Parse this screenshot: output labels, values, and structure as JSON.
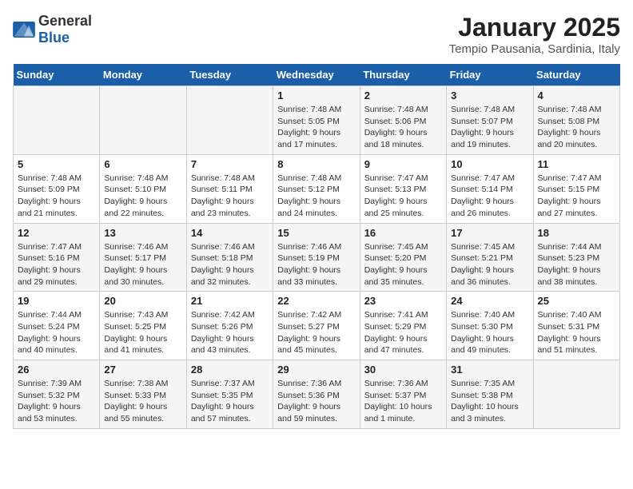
{
  "header": {
    "logo": {
      "general": "General",
      "blue": "Blue"
    },
    "title": "January 2025",
    "subtitle": "Tempio Pausania, Sardinia, Italy"
  },
  "weekdays": [
    "Sunday",
    "Monday",
    "Tuesday",
    "Wednesday",
    "Thursday",
    "Friday",
    "Saturday"
  ],
  "weeks": [
    [
      {
        "day": "",
        "info": ""
      },
      {
        "day": "",
        "info": ""
      },
      {
        "day": "",
        "info": ""
      },
      {
        "day": "1",
        "info": "Sunrise: 7:48 AM\nSunset: 5:05 PM\nDaylight: 9 hours\nand 17 minutes."
      },
      {
        "day": "2",
        "info": "Sunrise: 7:48 AM\nSunset: 5:06 PM\nDaylight: 9 hours\nand 18 minutes."
      },
      {
        "day": "3",
        "info": "Sunrise: 7:48 AM\nSunset: 5:07 PM\nDaylight: 9 hours\nand 19 minutes."
      },
      {
        "day": "4",
        "info": "Sunrise: 7:48 AM\nSunset: 5:08 PM\nDaylight: 9 hours\nand 20 minutes."
      }
    ],
    [
      {
        "day": "5",
        "info": "Sunrise: 7:48 AM\nSunset: 5:09 PM\nDaylight: 9 hours\nand 21 minutes."
      },
      {
        "day": "6",
        "info": "Sunrise: 7:48 AM\nSunset: 5:10 PM\nDaylight: 9 hours\nand 22 minutes."
      },
      {
        "day": "7",
        "info": "Sunrise: 7:48 AM\nSunset: 5:11 PM\nDaylight: 9 hours\nand 23 minutes."
      },
      {
        "day": "8",
        "info": "Sunrise: 7:48 AM\nSunset: 5:12 PM\nDaylight: 9 hours\nand 24 minutes."
      },
      {
        "day": "9",
        "info": "Sunrise: 7:47 AM\nSunset: 5:13 PM\nDaylight: 9 hours\nand 25 minutes."
      },
      {
        "day": "10",
        "info": "Sunrise: 7:47 AM\nSunset: 5:14 PM\nDaylight: 9 hours\nand 26 minutes."
      },
      {
        "day": "11",
        "info": "Sunrise: 7:47 AM\nSunset: 5:15 PM\nDaylight: 9 hours\nand 27 minutes."
      }
    ],
    [
      {
        "day": "12",
        "info": "Sunrise: 7:47 AM\nSunset: 5:16 PM\nDaylight: 9 hours\nand 29 minutes."
      },
      {
        "day": "13",
        "info": "Sunrise: 7:46 AM\nSunset: 5:17 PM\nDaylight: 9 hours\nand 30 minutes."
      },
      {
        "day": "14",
        "info": "Sunrise: 7:46 AM\nSunset: 5:18 PM\nDaylight: 9 hours\nand 32 minutes."
      },
      {
        "day": "15",
        "info": "Sunrise: 7:46 AM\nSunset: 5:19 PM\nDaylight: 9 hours\nand 33 minutes."
      },
      {
        "day": "16",
        "info": "Sunrise: 7:45 AM\nSunset: 5:20 PM\nDaylight: 9 hours\nand 35 minutes."
      },
      {
        "day": "17",
        "info": "Sunrise: 7:45 AM\nSunset: 5:21 PM\nDaylight: 9 hours\nand 36 minutes."
      },
      {
        "day": "18",
        "info": "Sunrise: 7:44 AM\nSunset: 5:23 PM\nDaylight: 9 hours\nand 38 minutes."
      }
    ],
    [
      {
        "day": "19",
        "info": "Sunrise: 7:44 AM\nSunset: 5:24 PM\nDaylight: 9 hours\nand 40 minutes."
      },
      {
        "day": "20",
        "info": "Sunrise: 7:43 AM\nSunset: 5:25 PM\nDaylight: 9 hours\nand 41 minutes."
      },
      {
        "day": "21",
        "info": "Sunrise: 7:42 AM\nSunset: 5:26 PM\nDaylight: 9 hours\nand 43 minutes."
      },
      {
        "day": "22",
        "info": "Sunrise: 7:42 AM\nSunset: 5:27 PM\nDaylight: 9 hours\nand 45 minutes."
      },
      {
        "day": "23",
        "info": "Sunrise: 7:41 AM\nSunset: 5:29 PM\nDaylight: 9 hours\nand 47 minutes."
      },
      {
        "day": "24",
        "info": "Sunrise: 7:40 AM\nSunset: 5:30 PM\nDaylight: 9 hours\nand 49 minutes."
      },
      {
        "day": "25",
        "info": "Sunrise: 7:40 AM\nSunset: 5:31 PM\nDaylight: 9 hours\nand 51 minutes."
      }
    ],
    [
      {
        "day": "26",
        "info": "Sunrise: 7:39 AM\nSunset: 5:32 PM\nDaylight: 9 hours\nand 53 minutes."
      },
      {
        "day": "27",
        "info": "Sunrise: 7:38 AM\nSunset: 5:33 PM\nDaylight: 9 hours\nand 55 minutes."
      },
      {
        "day": "28",
        "info": "Sunrise: 7:37 AM\nSunset: 5:35 PM\nDaylight: 9 hours\nand 57 minutes."
      },
      {
        "day": "29",
        "info": "Sunrise: 7:36 AM\nSunset: 5:36 PM\nDaylight: 9 hours\nand 59 minutes."
      },
      {
        "day": "30",
        "info": "Sunrise: 7:36 AM\nSunset: 5:37 PM\nDaylight: 10 hours\nand 1 minute."
      },
      {
        "day": "31",
        "info": "Sunrise: 7:35 AM\nSunset: 5:38 PM\nDaylight: 10 hours\nand 3 minutes."
      },
      {
        "day": "",
        "info": ""
      }
    ]
  ]
}
